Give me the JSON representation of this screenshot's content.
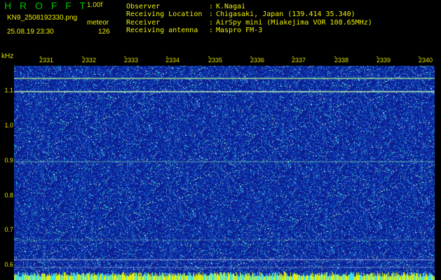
{
  "header": {
    "logo_text": "H R O F F T",
    "version": "1.00f",
    "filename": "KN9_2508192330.png",
    "meteor_label": "meteor",
    "datetime": "25.08.19 23:30",
    "meteor_count": "126"
  },
  "info": [
    {
      "label": "Observer",
      "value": "K.Nagai"
    },
    {
      "label": "Receiving Location",
      "value": "Chigasaki, Japan (139.414 35.340)"
    },
    {
      "label": "Receiver",
      "value": "AirSpy mini (Miakejima VOR 108.65MHz)"
    },
    {
      "label": "Receiving antenna",
      "value": "Maspro FM-3"
    }
  ],
  "axes": {
    "y_unit": "kHz",
    "y_ticks": [
      "1.1",
      "1.0",
      "0.9",
      "0.8",
      "0.7",
      "0.6"
    ],
    "x_ticks": [
      "2331",
      "2332",
      "2333",
      "2334",
      "2335",
      "2336",
      "2337",
      "2338",
      "2339",
      "2340"
    ]
  },
  "colors": {
    "background": "#000000",
    "label_yellow": "#f0f000",
    "logo_green": "#00c000",
    "spectrogram_base": "#0a1a8c",
    "trace_line": "#90ff90"
  }
}
